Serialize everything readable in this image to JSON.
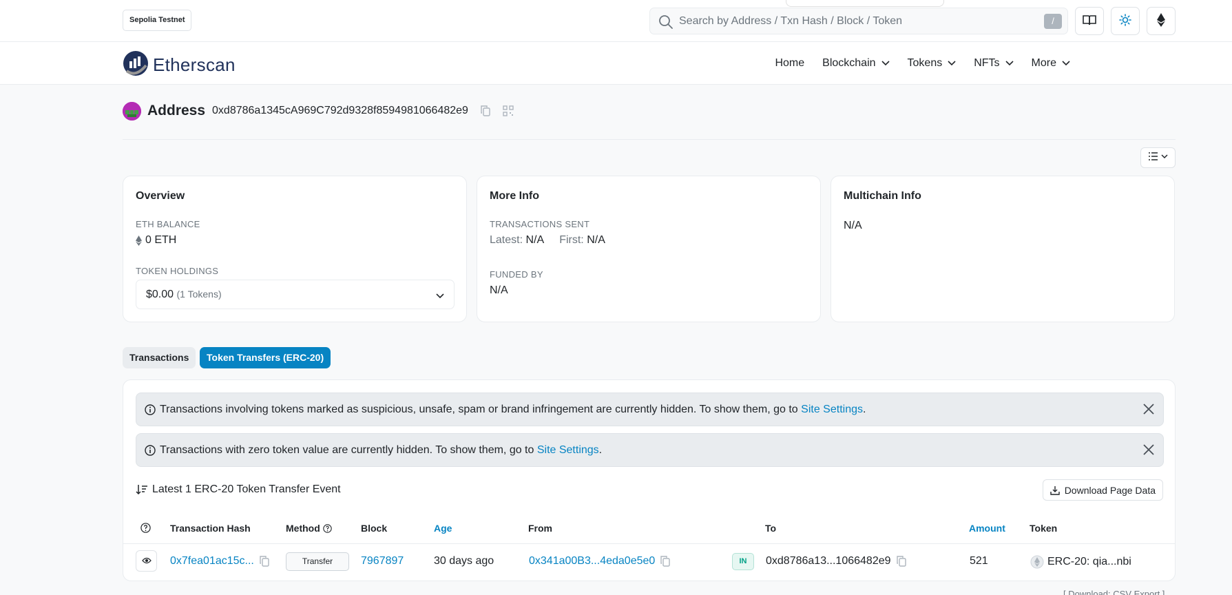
{
  "topbar": {
    "network_badge": "Sepolia Testnet",
    "search_placeholder": "Search by Address / Txn Hash / Block / Token",
    "search_shortcut": "/"
  },
  "nav": {
    "brand": "Etherscan",
    "items": [
      {
        "label": "Home",
        "dropdown": false
      },
      {
        "label": "Blockchain",
        "dropdown": true
      },
      {
        "label": "Tokens",
        "dropdown": true
      },
      {
        "label": "NFTs",
        "dropdown": true
      },
      {
        "label": "More",
        "dropdown": true
      }
    ]
  },
  "address": {
    "title": "Address",
    "hash": "0xd8786a1345cA969C792d9328f8594981066482e9"
  },
  "overview": {
    "title": "Overview",
    "eth_balance_label": "ETH BALANCE",
    "eth_balance_value": "0 ETH",
    "token_holdings_label": "TOKEN HOLDINGS",
    "token_holdings_value": "$0.00",
    "token_holdings_count": "(1 Tokens)"
  },
  "more_info": {
    "title": "More Info",
    "tx_sent_label": "TRANSACTIONS SENT",
    "latest_label": "Latest:",
    "latest_value": "N/A",
    "first_label": "First:",
    "first_value": "N/A",
    "funded_by_label": "FUNDED BY",
    "funded_by_value": "N/A"
  },
  "multichain": {
    "title": "Multichain Info",
    "value": "N/A"
  },
  "tabs": [
    {
      "label": "Transactions",
      "active": false
    },
    {
      "label": "Token Transfers (ERC-20)",
      "active": true
    }
  ],
  "alerts": [
    {
      "text": "Transactions involving tokens marked as suspicious, unsafe, spam or brand infringement are currently hidden. To show them, go to ",
      "link": "Site Settings",
      "suffix": "."
    },
    {
      "text": "Transactions with zero token value are currently hidden. To show them, go to ",
      "link": "Site Settings",
      "suffix": "."
    }
  ],
  "events": {
    "title": "Latest 1 ERC-20 Token Transfer Event",
    "download_label": "Download Page Data"
  },
  "table": {
    "headers": {
      "tx_hash": "Transaction Hash",
      "method": "Method",
      "block": "Block",
      "age": "Age",
      "from": "From",
      "to": "To",
      "amount": "Amount",
      "token": "Token"
    },
    "rows": [
      {
        "tx_hash": "0x7fea01ac15c...",
        "method": "Transfer",
        "block": "7967897",
        "age": "30 days ago",
        "from": "0x341a00B3...4eda0e5e0",
        "direction": "IN",
        "to": "0xd8786a13...1066482e9",
        "amount": "521",
        "token": "ERC-20: qia...nbi"
      }
    ]
  },
  "footer_fragment": "[ Download: CSV Export ]",
  "colors": {
    "accent": "#0784c3",
    "in_badge": "#00a186",
    "brand_dark": "#21325b"
  }
}
